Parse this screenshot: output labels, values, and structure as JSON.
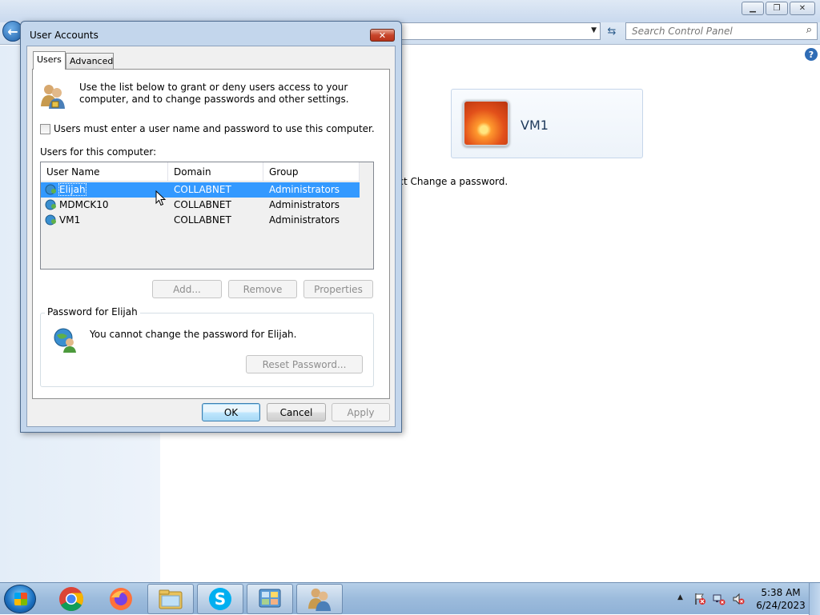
{
  "background_window": {
    "search_placeholder": "Search Control Panel",
    "user_tile_name": "VM1",
    "hint_text": "ect Change a password."
  },
  "dialog": {
    "title": "User Accounts",
    "tabs": [
      {
        "label": "Users",
        "active": true
      },
      {
        "label": "Advanced",
        "active": false
      }
    ],
    "intro_text": "Use the list below to grant or deny users access to your computer, and to change passwords and other settings.",
    "must_login_checkbox": {
      "label": "Users must enter a user name and password to use this computer.",
      "checked": false
    },
    "users_label": "Users for this computer:",
    "columns": [
      "User Name",
      "Domain",
      "Group"
    ],
    "users": [
      {
        "name": "Elijah",
        "domain": "COLLABNET",
        "group": "Administrators",
        "selected": true
      },
      {
        "name": "MDMCK10",
        "domain": "COLLABNET",
        "group": "Administrators",
        "selected": false
      },
      {
        "name": "VM1",
        "domain": "COLLABNET",
        "group": "Administrators",
        "selected": false
      }
    ],
    "buttons": {
      "add": "Add...",
      "remove": "Remove",
      "properties": "Properties",
      "reset_password": "Reset Password...",
      "ok": "OK",
      "cancel": "Cancel",
      "apply": "Apply"
    },
    "password_group": {
      "title": "Password for Elijah",
      "message": "You cannot change the password for Elijah."
    },
    "close_glyph": "✕"
  },
  "taskbar": {
    "time": "5:38 AM",
    "date": "6/24/2023",
    "items": [
      "chrome-icon",
      "firefox-icon",
      "file-explorer-icon",
      "skype-icon",
      "control-panel-icon",
      "user-accounts-icon"
    ]
  },
  "colors": {
    "selection": "#3399ff",
    "dialog_frame": "#c3d6ec",
    "taskbar": "#9cbbdc"
  }
}
